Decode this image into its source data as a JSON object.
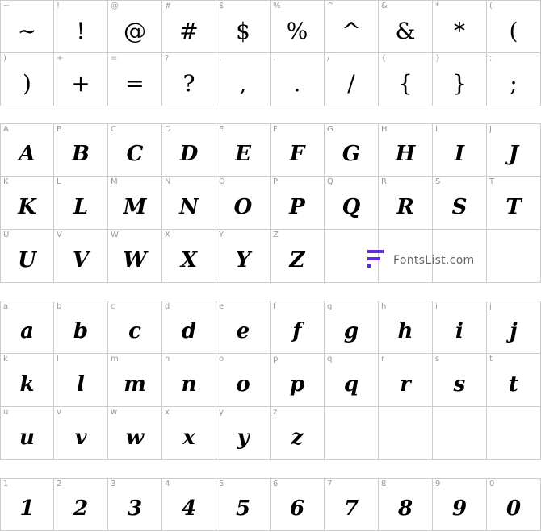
{
  "punct": [
    {
      "label": "~",
      "glyph": "~"
    },
    {
      "label": "!",
      "glyph": "!"
    },
    {
      "label": "@",
      "glyph": "@"
    },
    {
      "label": "#",
      "glyph": "#"
    },
    {
      "label": "$",
      "glyph": "$"
    },
    {
      "label": "%",
      "glyph": "%"
    },
    {
      "label": "^",
      "glyph": "^"
    },
    {
      "label": "&",
      "glyph": "&"
    },
    {
      "label": "*",
      "glyph": "*"
    },
    {
      "label": "(",
      "glyph": "("
    },
    {
      "label": ")",
      "glyph": ")"
    },
    {
      "label": "+",
      "glyph": "+"
    },
    {
      "label": "=",
      "glyph": "="
    },
    {
      "label": "?",
      "glyph": "?"
    },
    {
      "label": ",",
      "glyph": ","
    },
    {
      "label": ".",
      "glyph": "."
    },
    {
      "label": "/",
      "glyph": "/"
    },
    {
      "label": "{",
      "glyph": "{"
    },
    {
      "label": "}",
      "glyph": "}"
    },
    {
      "label": ";",
      "glyph": ";"
    }
  ],
  "upper": [
    {
      "label": "A",
      "glyph": "A"
    },
    {
      "label": "B",
      "glyph": "B"
    },
    {
      "label": "C",
      "glyph": "C"
    },
    {
      "label": "D",
      "glyph": "D"
    },
    {
      "label": "E",
      "glyph": "E"
    },
    {
      "label": "F",
      "glyph": "F"
    },
    {
      "label": "G",
      "glyph": "G"
    },
    {
      "label": "H",
      "glyph": "H"
    },
    {
      "label": "I",
      "glyph": "I"
    },
    {
      "label": "J",
      "glyph": "J"
    },
    {
      "label": "K",
      "glyph": "K"
    },
    {
      "label": "L",
      "glyph": "L"
    },
    {
      "label": "M",
      "glyph": "M"
    },
    {
      "label": "N",
      "glyph": "N"
    },
    {
      "label": "O",
      "glyph": "O"
    },
    {
      "label": "P",
      "glyph": "P"
    },
    {
      "label": "Q",
      "glyph": "Q"
    },
    {
      "label": "R",
      "glyph": "R"
    },
    {
      "label": "S",
      "glyph": "S"
    },
    {
      "label": "T",
      "glyph": "T"
    },
    {
      "label": "U",
      "glyph": "U"
    },
    {
      "label": "V",
      "glyph": "V"
    },
    {
      "label": "W",
      "glyph": "W"
    },
    {
      "label": "X",
      "glyph": "X"
    },
    {
      "label": "Y",
      "glyph": "Y"
    },
    {
      "label": "Z",
      "glyph": "Z"
    },
    {
      "label": "",
      "glyph": ""
    },
    {
      "label": "",
      "glyph": ""
    },
    {
      "label": "",
      "glyph": ""
    },
    {
      "label": "",
      "glyph": ""
    }
  ],
  "lower": [
    {
      "label": "a",
      "glyph": "a"
    },
    {
      "label": "b",
      "glyph": "b"
    },
    {
      "label": "c",
      "glyph": "c"
    },
    {
      "label": "d",
      "glyph": "d"
    },
    {
      "label": "e",
      "glyph": "e"
    },
    {
      "label": "f",
      "glyph": "f"
    },
    {
      "label": "g",
      "glyph": "g"
    },
    {
      "label": "h",
      "glyph": "h"
    },
    {
      "label": "i",
      "glyph": "i"
    },
    {
      "label": "j",
      "glyph": "j"
    },
    {
      "label": "k",
      "glyph": "k"
    },
    {
      "label": "l",
      "glyph": "l"
    },
    {
      "label": "m",
      "glyph": "m"
    },
    {
      "label": "n",
      "glyph": "n"
    },
    {
      "label": "o",
      "glyph": "o"
    },
    {
      "label": "p",
      "glyph": "p"
    },
    {
      "label": "q",
      "glyph": "q"
    },
    {
      "label": "r",
      "glyph": "r"
    },
    {
      "label": "s",
      "glyph": "s"
    },
    {
      "label": "t",
      "glyph": "t"
    },
    {
      "label": "u",
      "glyph": "u"
    },
    {
      "label": "v",
      "glyph": "v"
    },
    {
      "label": "w",
      "glyph": "w"
    },
    {
      "label": "x",
      "glyph": "x"
    },
    {
      "label": "y",
      "glyph": "y"
    },
    {
      "label": "z",
      "glyph": "z"
    },
    {
      "label": "",
      "glyph": ""
    },
    {
      "label": "",
      "glyph": ""
    },
    {
      "label": "",
      "glyph": ""
    },
    {
      "label": "",
      "glyph": ""
    }
  ],
  "digits": [
    {
      "label": "1",
      "glyph": "1"
    },
    {
      "label": "2",
      "glyph": "2"
    },
    {
      "label": "3",
      "glyph": "3"
    },
    {
      "label": "4",
      "glyph": "4"
    },
    {
      "label": "5",
      "glyph": "5"
    },
    {
      "label": "6",
      "glyph": "6"
    },
    {
      "label": "7",
      "glyph": "7"
    },
    {
      "label": "8",
      "glyph": "8"
    },
    {
      "label": "9",
      "glyph": "9"
    },
    {
      "label": "0",
      "glyph": "0"
    }
  ],
  "watermark": {
    "text": "FontsList.com",
    "color": "#5b2bdc"
  }
}
